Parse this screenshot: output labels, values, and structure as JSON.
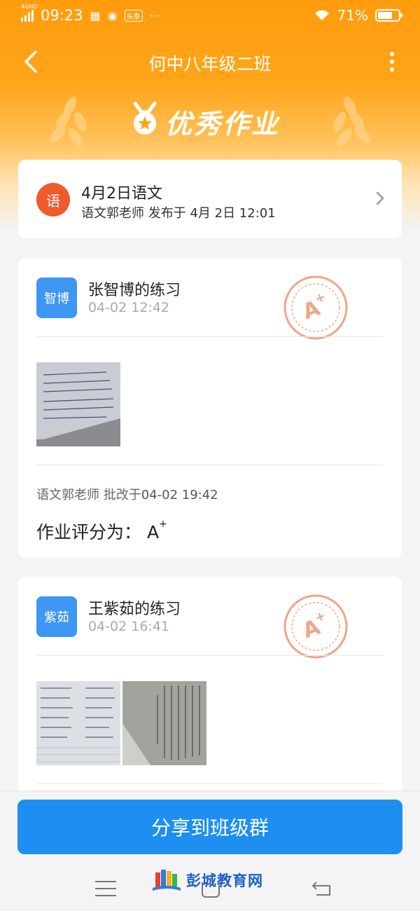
{
  "status_bar": {
    "network": "4GHD",
    "time": "09:23",
    "badge": "头条",
    "battery": "71%"
  },
  "navbar": {
    "title": "何中八年级二班"
  },
  "banner": {
    "title": "优秀作业"
  },
  "homework": {
    "subject_char": "语",
    "title": "4月2日语文",
    "subtitle": "语文郭老师 发布于 4月 2日 12:01"
  },
  "submissions": [
    {
      "avatar_text": "智博",
      "name": "张智博的练习",
      "time": "04-02 12:42",
      "reviewer": "语文郭老师 批改于",
      "review_time": "04-02 19:42",
      "score_label": "作业评分为：",
      "score": "A",
      "score_sup": "+"
    },
    {
      "avatar_text": "紫茹",
      "name": "王紫茹的练习",
      "time": "04-02 16:41"
    }
  ],
  "share_button": "分享到班级群",
  "watermark": "彭城教育网",
  "colors": {
    "brand_orange": "#ff9c0d",
    "primary_blue": "#1e8ef0",
    "subject_red": "#f15a2b",
    "avatar_blue": "#3d97f3",
    "stamp_color": "#f0a48a"
  }
}
